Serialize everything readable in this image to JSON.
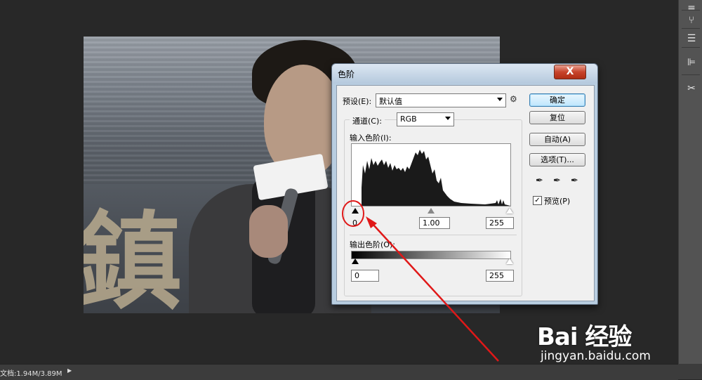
{
  "status_bar": {
    "doc_size": "文档:1.94M/3.89M"
  },
  "photo": {
    "sign_text": "鎮"
  },
  "dialog": {
    "title": "色阶",
    "close_label": "X",
    "preset_label": "预设(E):",
    "preset_value": "默认值",
    "buttons": {
      "ok": "确定",
      "reset": "复位",
      "auto": "自动(A)",
      "options": "选项(T)..."
    },
    "channel_label": "通道(C):",
    "channel_value": "RGB",
    "input_levels_label": "输入色阶(I):",
    "input_values": {
      "shadow": "0",
      "gamma": "1.00",
      "highlight": "255"
    },
    "output_levels_label": "输出色阶(O):",
    "output_values": {
      "low": "0",
      "high": "255"
    },
    "preview_label": "预览(P)",
    "preview_checked": true
  },
  "watermark": {
    "logo": "Bai 经验",
    "url": "jingyan.baidu.com"
  }
}
